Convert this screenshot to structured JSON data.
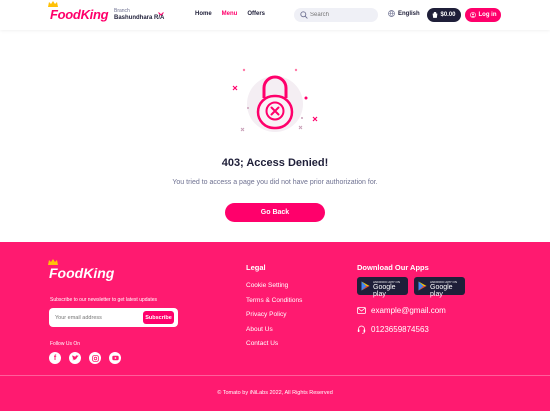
{
  "header": {
    "logo": "FoodKing",
    "branch_label": "Branch",
    "branch_value": "Bashundhara R/A",
    "nav": [
      "Home",
      "Menu",
      "Offers"
    ],
    "search_placeholder": "Search",
    "language": "English",
    "cart_total": "$0.00",
    "login_label": "Log in"
  },
  "main": {
    "title": "403; Access Denied!",
    "description": "You tried to access a page you did not have prior authorization for.",
    "button_label": "Go Back"
  },
  "footer": {
    "logo": "FoodKing",
    "subscribe_text": "Subscribe to our newsletter to get latest updates",
    "email_placeholder": "Your email address",
    "subscribe_button": "Subscribe",
    "follow_label": "Follow Us On",
    "legal_title": "Legal",
    "legal_links": [
      "Cookie Setting",
      "Terms & Conditions",
      "Privacy Policy",
      "About Us",
      "Contact Us"
    ],
    "apps_title": "Download Our Apps",
    "app_buttons": [
      {
        "small": "ANDROID APP ON",
        "big": "Google play"
      },
      {
        "small": "ANDROID APP ON",
        "big": "Google play"
      }
    ],
    "email": "example@gmail.com",
    "phone": "0123659874563",
    "copyright": "© Tomato by iNiLabs 2022, All Rights Reserved"
  },
  "colors": {
    "brand": "#ff006b",
    "footer_bg": "#ff1a70",
    "dark": "#1f1f39"
  }
}
